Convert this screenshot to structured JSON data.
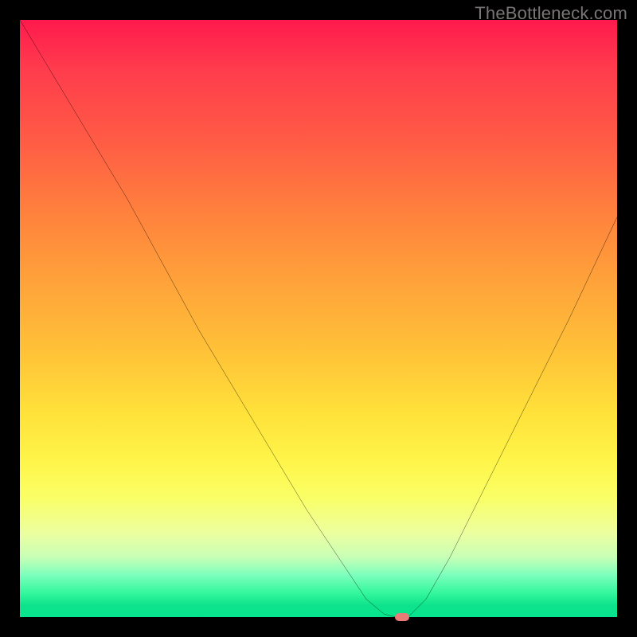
{
  "watermark": "TheBottleneck.com",
  "chart_data": {
    "type": "line",
    "title": "",
    "xlabel": "",
    "ylabel": "",
    "xlim": [
      0,
      100
    ],
    "ylim": [
      0,
      100
    ],
    "grid": false,
    "legend": false,
    "series": [
      {
        "name": "bottleneck-curve",
        "x": [
          0,
          6,
          12,
          18,
          24,
          30,
          36,
          42,
          48,
          54,
          58,
          61,
          63,
          65,
          68,
          72,
          78,
          85,
          92,
          100
        ],
        "values": [
          100,
          90,
          80,
          70,
          59,
          48,
          38,
          28,
          18,
          9,
          3,
          0.5,
          0,
          0,
          3,
          10,
          22,
          36,
          50,
          67
        ]
      }
    ],
    "annotations": [
      {
        "name": "min-marker",
        "x": 64,
        "y": 0
      }
    ],
    "background_gradient_stops": [
      {
        "pos": 0.0,
        "color": "#ff1a4d"
      },
      {
        "pos": 0.5,
        "color": "#ffc338"
      },
      {
        "pos": 0.8,
        "color": "#faff66"
      },
      {
        "pos": 1.0,
        "color": "#06e48d"
      }
    ]
  }
}
